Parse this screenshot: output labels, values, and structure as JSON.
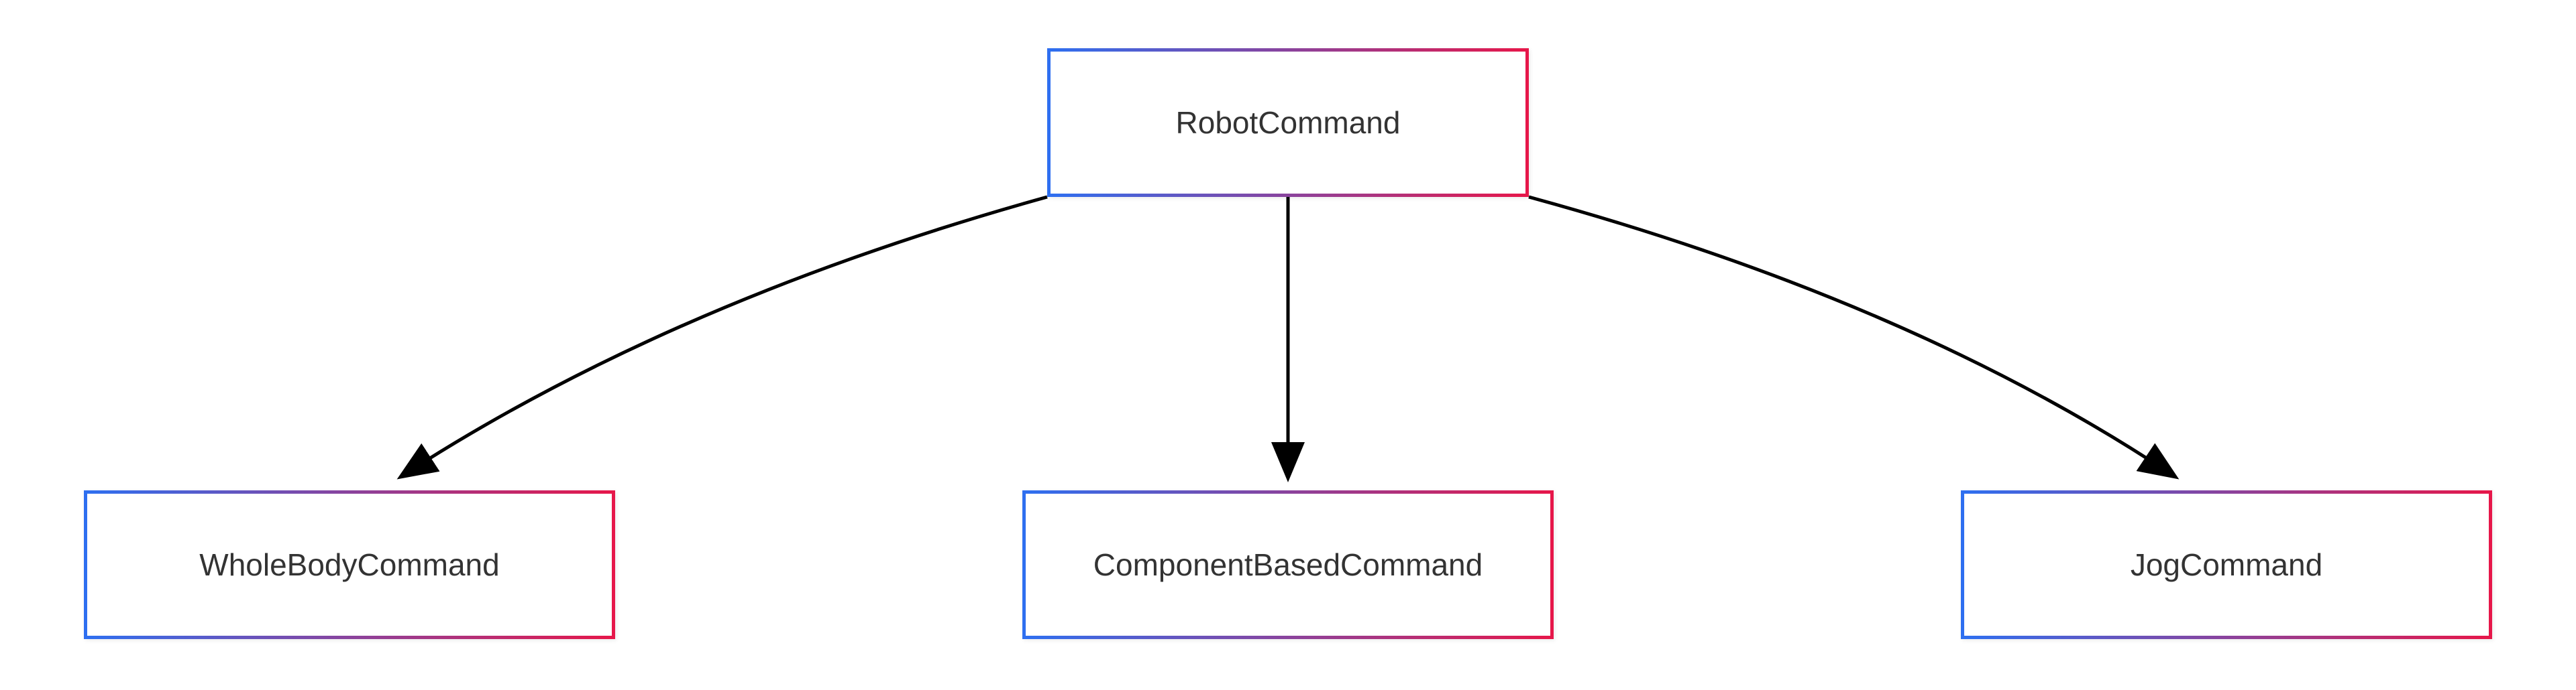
{
  "nodes": {
    "root": {
      "label": "RobotCommand"
    },
    "child1": {
      "label": "WholeBodyCommand"
    },
    "child2": {
      "label": "ComponentBasedCommand"
    },
    "child3": {
      "label": "JogCommand"
    }
  },
  "chart_data": {
    "type": "tree",
    "root": "RobotCommand",
    "children": [
      "WholeBodyCommand",
      "ComponentBasedCommand",
      "JogCommand"
    ]
  }
}
